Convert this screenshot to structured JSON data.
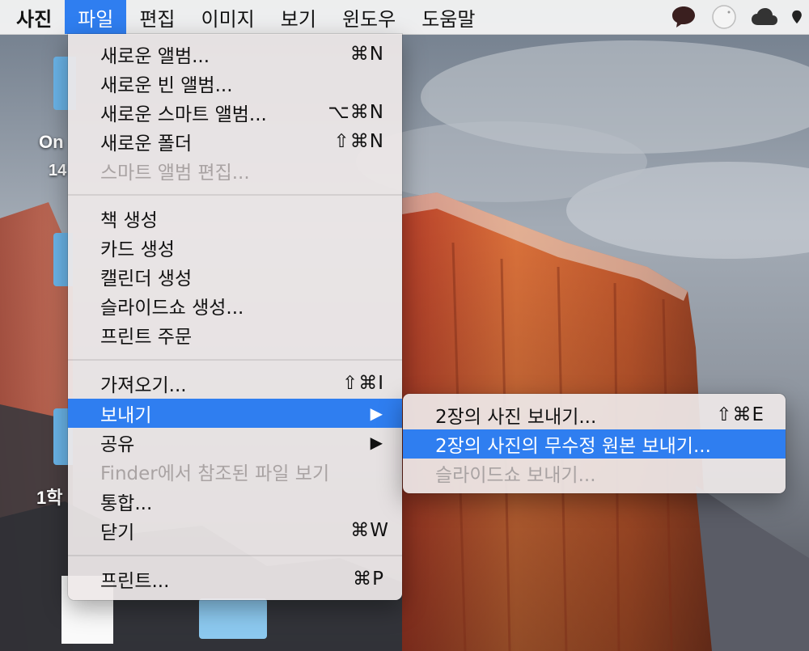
{
  "menubar": {
    "app_name": "사진",
    "menus": [
      "파일",
      "편집",
      "이미지",
      "보기",
      "윈도우",
      "도움말"
    ]
  },
  "desktop": {
    "labels": [
      "On",
      "14",
      "1학"
    ]
  },
  "file_menu": {
    "groups": [
      [
        {
          "label": "새로운 앨범...",
          "shortcut": "⌘N",
          "enabled": true
        },
        {
          "label": "새로운 빈 앨범...",
          "shortcut": "",
          "enabled": true
        },
        {
          "label": "새로운 스마트 앨범...",
          "shortcut": "⌥⌘N",
          "enabled": true
        },
        {
          "label": "새로운 폴더",
          "shortcut": "⇧⌘N",
          "enabled": true
        },
        {
          "label": "스마트 앨범 편집...",
          "shortcut": "",
          "enabled": false
        }
      ],
      [
        {
          "label": "책 생성",
          "shortcut": "",
          "enabled": true
        },
        {
          "label": "카드 생성",
          "shortcut": "",
          "enabled": true
        },
        {
          "label": "캘린더 생성",
          "shortcut": "",
          "enabled": true
        },
        {
          "label": "슬라이드쇼 생성...",
          "shortcut": "",
          "enabled": true
        },
        {
          "label": "프린트 주문",
          "shortcut": "",
          "enabled": true
        }
      ],
      [
        {
          "label": "가져오기...",
          "shortcut": "⇧⌘I",
          "enabled": true
        },
        {
          "label": "보내기",
          "submenu_arrow": "▶",
          "enabled": true,
          "highlighted": true
        },
        {
          "label": "공유",
          "submenu_arrow": "▶",
          "enabled": true
        },
        {
          "label": "Finder에서 참조된 파일 보기",
          "shortcut": "",
          "enabled": false
        },
        {
          "label": "통합...",
          "shortcut": "",
          "enabled": true
        },
        {
          "label": "닫기",
          "shortcut": "⌘W",
          "enabled": true
        }
      ],
      [
        {
          "label": "프린트...",
          "shortcut": "⌘P",
          "enabled": true
        }
      ]
    ]
  },
  "export_submenu": {
    "items": [
      {
        "label": "2장의 사진 보내기...",
        "shortcut": "⇧⌘E",
        "enabled": true
      },
      {
        "label": "2장의 사진의 무수정 원본 보내기...",
        "shortcut": "",
        "enabled": true,
        "highlighted": true
      },
      {
        "label": "슬라이드쇼 보내기...",
        "shortcut": "",
        "enabled": false
      }
    ]
  },
  "colors": {
    "highlight": "#2f7ef0",
    "disabled_text": "#a9a3a3"
  }
}
